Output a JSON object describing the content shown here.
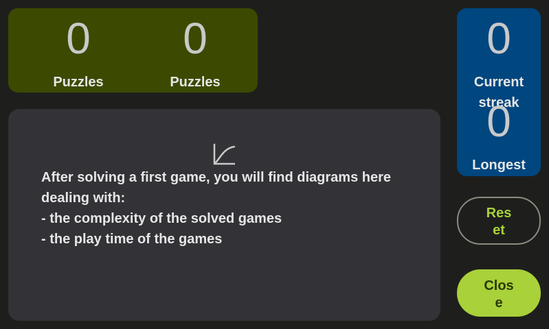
{
  "stats": {
    "puzzles_started": {
      "value": "0",
      "label": "Puzzles started"
    },
    "puzzles_solved": {
      "value": "0",
      "label": "Puzzles solved"
    }
  },
  "streak": {
    "current": {
      "value": "0",
      "label": "Current streak"
    },
    "longest": {
      "value": "0",
      "label": "Longest streak"
    }
  },
  "diagrams": {
    "icon": "line-chart-icon",
    "lines": [
      "After solving a first game, you will find diagrams here dealing with:",
      "- the complexity of the solved games",
      "- the play time of the games"
    ]
  },
  "buttons": {
    "reset": "Reset",
    "close": "Close"
  },
  "colors": {
    "background": "#1e1f1c",
    "stats_card": "#3b4a00",
    "streak_card": "#00467f",
    "diagram_card": "#323237",
    "accent": "#a9d13a"
  }
}
